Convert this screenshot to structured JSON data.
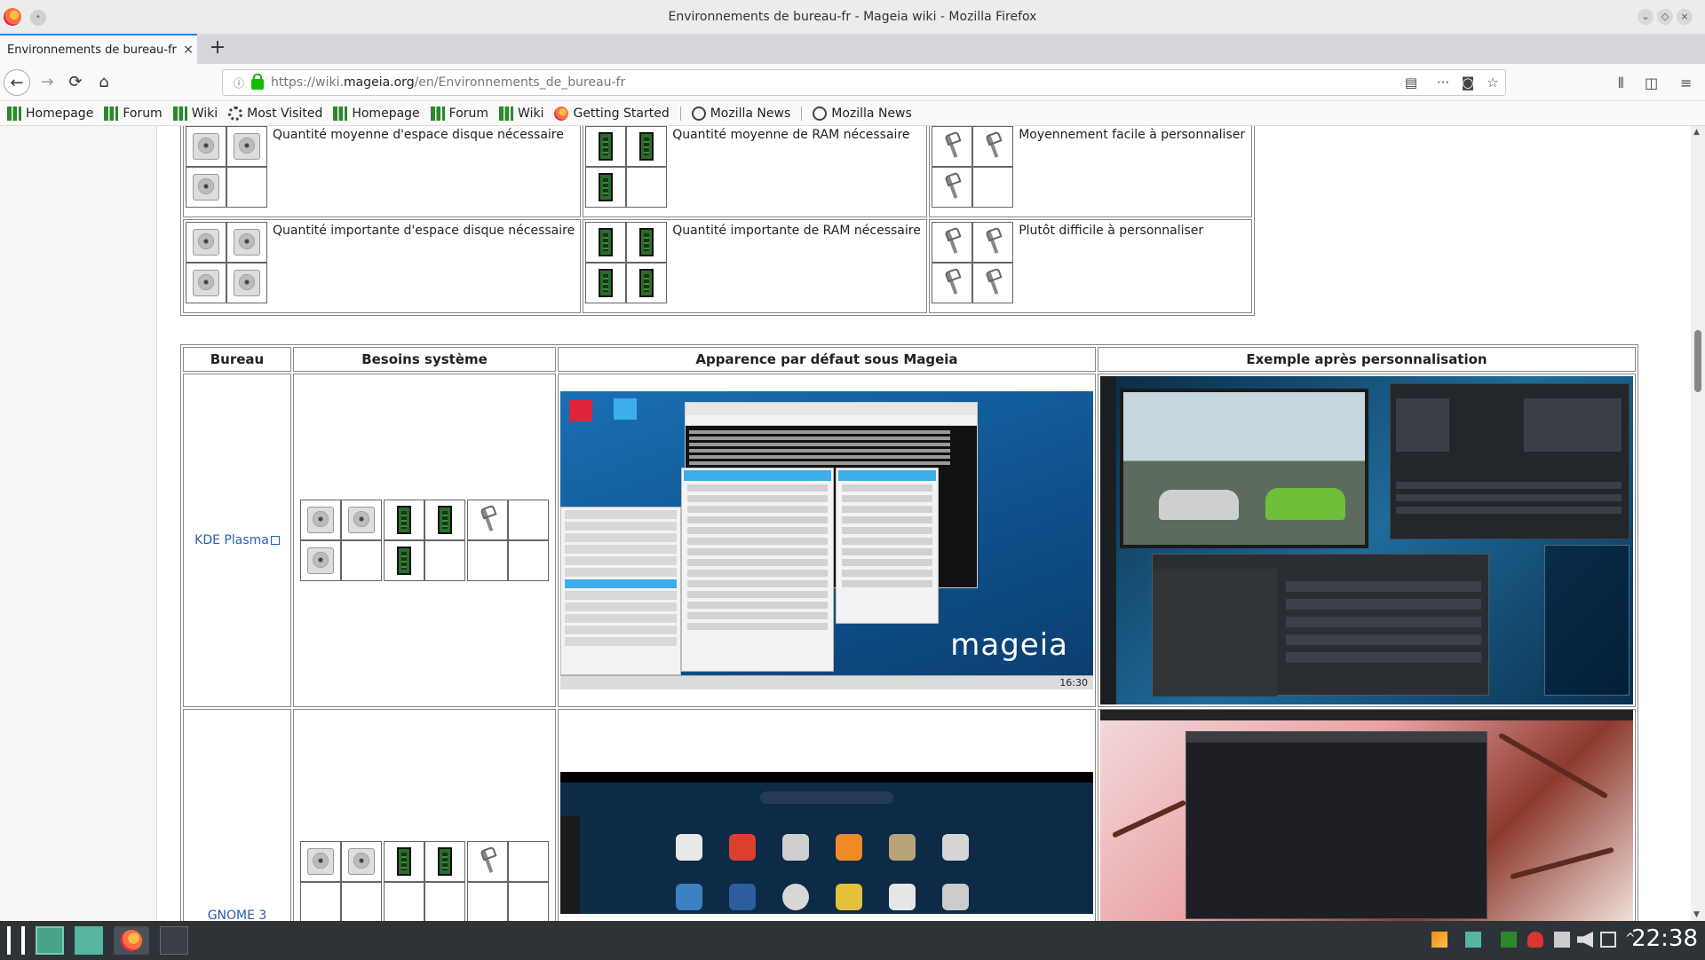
{
  "window": {
    "title": "Environnements de bureau-fr - Mageia wiki - Mozilla Firefox"
  },
  "tab": {
    "label": "Environnements de bureau-fr",
    "close_glyph": "×",
    "new_tab_glyph": "+"
  },
  "nav": {
    "url_prefix": "https://wiki.",
    "url_domain": "mageia.org",
    "url_path": "/en/Environnements_de_bureau-fr",
    "back_glyph": "←",
    "forward_glyph": "→",
    "reload_glyph": "⟳",
    "home_glyph": "⌂",
    "info_glyph": "ⓘ",
    "reader_glyph": "▤",
    "more_glyph": "···",
    "pocket_glyph": "◙",
    "star_glyph": "☆",
    "library_glyph": "⫴",
    "sidebar_glyph": "◫",
    "menu_glyph": "≡"
  },
  "bookmarks": [
    {
      "label": "Homepage",
      "icon": "mageia-icon"
    },
    {
      "label": "Forum",
      "icon": "mageia-icon"
    },
    {
      "label": "Wiki",
      "icon": "mageia-icon"
    },
    {
      "label": "Most Visited",
      "icon": "gear-icon"
    },
    {
      "label": "Homepage",
      "icon": "mageia-icon"
    },
    {
      "label": "Forum",
      "icon": "mageia-icon"
    },
    {
      "label": "Wiki",
      "icon": "mageia-icon"
    },
    {
      "label": "Getting Started",
      "icon": "firefox-icon"
    },
    {
      "label": "Mozilla News",
      "icon": "globe-icon"
    },
    {
      "label": "Mozilla News",
      "icon": "globe-icon"
    }
  ],
  "legend": {
    "row1": {
      "disk": "Quantité moyenne d'espace disque nécessaire",
      "ram": "Quantité moyenne de RAM nécessaire",
      "custom": "Moyennement facile à personnaliser"
    },
    "row2": {
      "disk": "Quantité importante d'espace disque nécessaire",
      "ram": "Quantité importante de RAM nécessaire",
      "custom": "Plutôt difficile à personnaliser"
    }
  },
  "table": {
    "headers": {
      "bureau": "Bureau",
      "besoins": "Besoins système",
      "apparence": "Apparence par défaut sous Mageia",
      "exemple": "Exemple après personnalisation"
    },
    "rows": [
      {
        "name": "KDE Plasma"
      },
      {
        "name": "GNOME 3"
      }
    ]
  },
  "screenshots": {
    "kde_default": {
      "brand": "mageia",
      "clock": "16:30"
    }
  },
  "taskbar": {
    "clock": "22:38"
  }
}
